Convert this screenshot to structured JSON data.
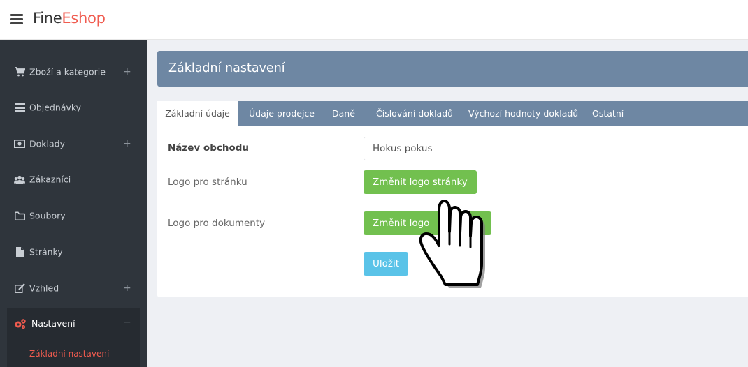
{
  "brand": {
    "part1": "Fine",
    "part2": "Eshop"
  },
  "sidebar": {
    "items": [
      {
        "label": "Zboží a kategorie",
        "icon": "shopping-cart-icon",
        "expand": "+"
      },
      {
        "label": "Objednávky",
        "icon": "list-icon"
      },
      {
        "label": "Doklady",
        "icon": "money-bill-icon",
        "expand": "+"
      },
      {
        "label": "Zákazníci",
        "icon": "users-icon"
      },
      {
        "label": "Soubory",
        "icon": "folder-icon"
      },
      {
        "label": "Stránky",
        "icon": "file-icon"
      },
      {
        "label": "Vzhled",
        "icon": "edit-icon",
        "expand": "+"
      }
    ],
    "active": {
      "label": "Nastavení",
      "icon": "cogs-icon",
      "collapse": "−",
      "sub_item": "Základní nastavení"
    }
  },
  "page": {
    "title": "Základní nastavení"
  },
  "tabs": [
    {
      "label": "Základní údaje",
      "active": true
    },
    {
      "label": "Údaje prodejce"
    },
    {
      "label": "Daně"
    },
    {
      "label": "Číslování dokladů"
    },
    {
      "label": "Výchozí hodnoty dokladů"
    },
    {
      "label": "Ostatní"
    }
  ],
  "form": {
    "shop_name_label": "Název obchodu",
    "shop_name_value": "Hokus pokus",
    "page_logo_label": "Logo pro stránku",
    "page_logo_button": "Změnit logo stránky",
    "doc_logo_label": "Logo pro dokumenty",
    "doc_logo_button": "Změnit logo",
    "save_button": "Uložit"
  },
  "colors": {
    "accent": "#f05b4f",
    "header": "#6e87a3",
    "sidebar": "#2f353c",
    "button_green": "#72c04f",
    "button_blue": "#5ac3e8"
  }
}
